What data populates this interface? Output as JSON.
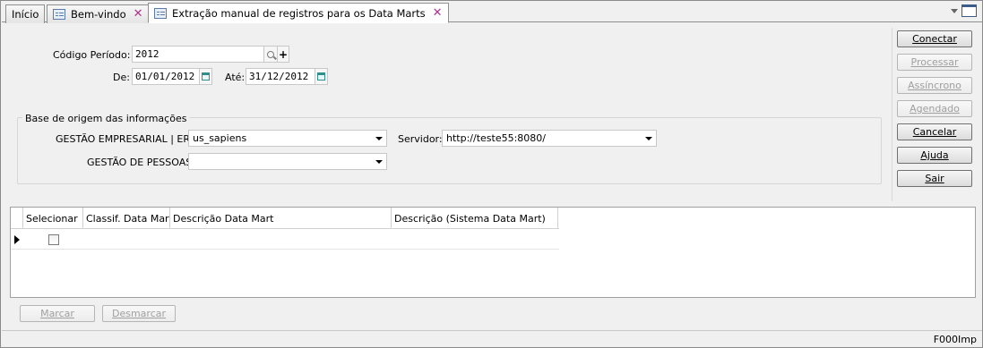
{
  "tabs": [
    {
      "label": "Início"
    },
    {
      "label": "Bem-vindo"
    },
    {
      "label": "Extração manual de registros para os Data Marts"
    }
  ],
  "form": {
    "codigo_periodo_label": "Código Período:",
    "codigo_periodo_value": "2012",
    "de_label": "De:",
    "de_value": "01/01/2012",
    "ate_label": "Até:",
    "ate_value": "31/12/2012",
    "group_title": "Base de origem das informações",
    "erp_label": "GESTÃO EMPRESARIAL | ERP:",
    "erp_value": "us_sapiens",
    "servidor_label": "Servidor:",
    "servidor_value": "http://teste55:8080/",
    "pessoas_label": "GESTÃO DE PESSOAS:",
    "pessoas_value": ""
  },
  "buttons": {
    "conectar": "Conectar",
    "processar": "Processar",
    "assincrono": "Assíncrono",
    "agendado": "Agendado",
    "cancelar": "Cancelar",
    "ajuda": "Ajuda",
    "sair": "Sair"
  },
  "grid": {
    "columns": [
      "Selecionar",
      "Classif. Data Mart",
      "Descrição Data Mart",
      "Descrição (Sistema Data Mart)"
    ]
  },
  "bottom_buttons": {
    "marcar": "Marcar",
    "desmarcar": "Desmarcar"
  },
  "status": {
    "code": "F000Imp"
  }
}
